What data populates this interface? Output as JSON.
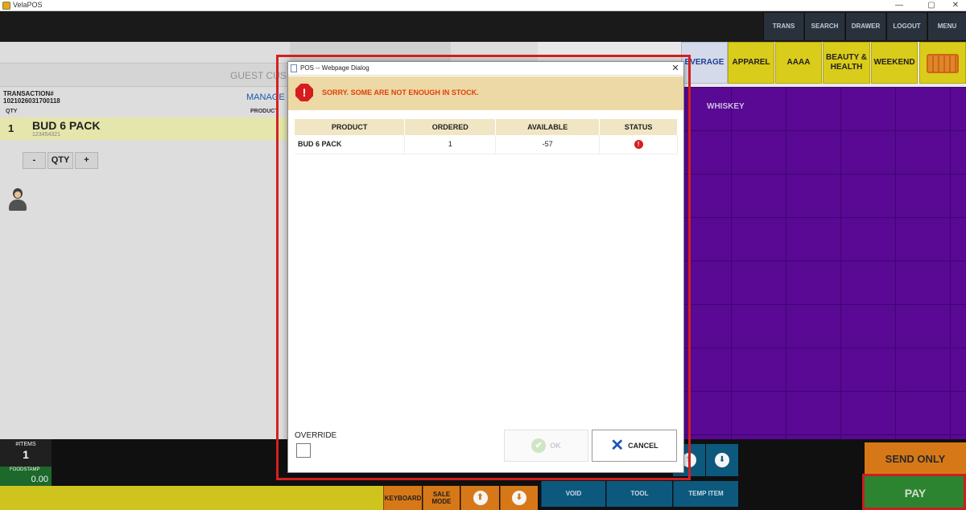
{
  "window": {
    "title": "VelaPOS",
    "minimize": "—",
    "restore": "▢",
    "close": "✕"
  },
  "nav": [
    "TRANS",
    "SEARCH",
    "DRAWER",
    "LOGOUT",
    "MENU"
  ],
  "left": {
    "guest": "GUEST CUS",
    "transaction_label": "TRANSACTION#",
    "transaction_number": "1021026031700118",
    "manager": "MANAGE",
    "col_qty": "QTY",
    "col_product": "PRODUCT",
    "item": {
      "qty": "1",
      "name": "BUD 6 PACK",
      "sku": "123454321"
    },
    "qty_minus": "-",
    "qty_label": "QTY",
    "qty_plus": "+"
  },
  "categories": [
    "EVERAGE",
    "APPAREL",
    "AAAA",
    "BEAUTY & HEALTH",
    "WEEKEND"
  ],
  "grid": {
    "whiskey": "WHISKEY"
  },
  "bottom": {
    "items_label": "#ITEMS",
    "items_count": "1",
    "foodstamp_label": "FOODSTAMP",
    "foodstamp_value": "0.00",
    "keyboard": "KEYBOARD",
    "sale_mode": "SALE MODE",
    "void": "VOID",
    "tool": "TOOL",
    "temp_item": "TEMP ITEM",
    "send_only": "SEND ONLY",
    "pay": "PAY",
    "up_glyph": "⬆",
    "down_glyph": "⬇"
  },
  "dialog": {
    "title": "POS -- Webpage Dialog",
    "close": "✕",
    "alert_glyph": "!",
    "message": "SORRY. SOME ARE NOT ENOUGH IN STOCK.",
    "headers": [
      "PRODUCT",
      "ORDERED",
      "AVAILABLE",
      "STATUS"
    ],
    "rows": [
      {
        "product": "BUD 6 PACK",
        "ordered": "1",
        "available": "-57",
        "status": "!"
      }
    ],
    "override_label": "OVERRIDE",
    "ok_label": "OK",
    "ok_glyph": "✔",
    "cancel_label": "CANCEL",
    "cancel_glyph": "✕"
  },
  "colors": {
    "accent_yellow": "#e3d51c",
    "purple": "#5d0a9a",
    "teal": "#0e5d84",
    "orange": "#e07d1a",
    "green": "#2e8a33",
    "alert_red": "#d51d1d"
  }
}
